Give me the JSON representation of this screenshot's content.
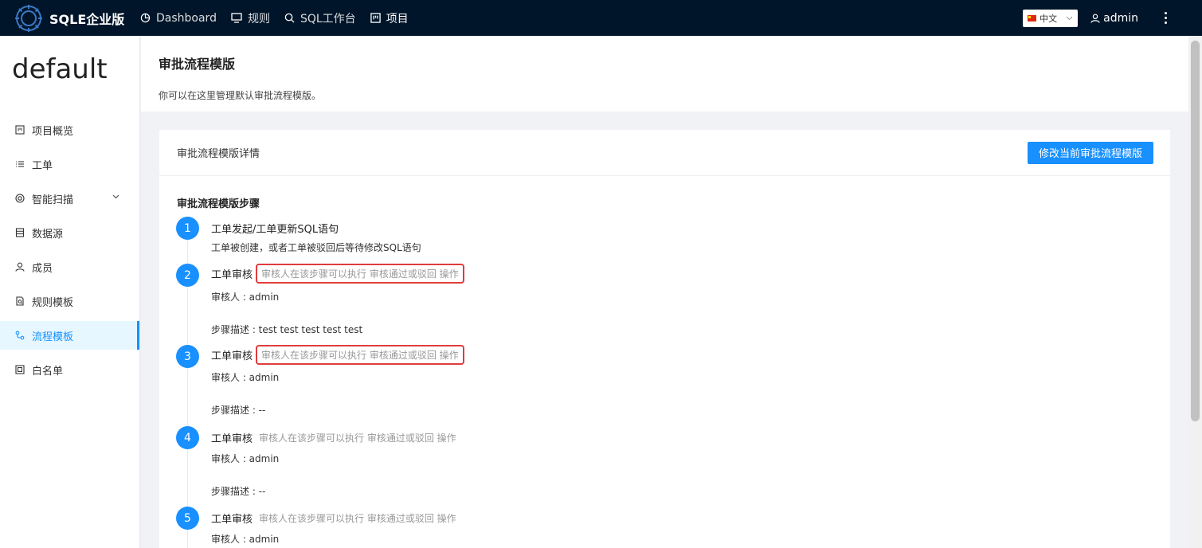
{
  "app": {
    "name": "SQLE企业版"
  },
  "nav": {
    "items": [
      {
        "label": "Dashboard"
      },
      {
        "label": "规则"
      },
      {
        "label": "SQL工作台"
      },
      {
        "label": "项目"
      }
    ]
  },
  "header_right": {
    "language": "中文",
    "user": "admin"
  },
  "sidebar": {
    "project": "default",
    "items": [
      {
        "label": "项目概览"
      },
      {
        "label": "工单"
      },
      {
        "label": "智能扫描"
      },
      {
        "label": "数据源"
      },
      {
        "label": "成员"
      },
      {
        "label": "规则模板"
      },
      {
        "label": "流程模板"
      },
      {
        "label": "白名单"
      }
    ]
  },
  "page": {
    "title": "审批流程模版",
    "description": "你可以在这里管理默认审批流程模版。"
  },
  "card": {
    "title": "审批流程模版详情",
    "edit_button": "修改当前审批流程模版",
    "steps_title": "审批流程模版步骤",
    "steps": [
      {
        "num": "1",
        "title": "工单发起/工单更新SQL语句",
        "hint": "",
        "lines": [
          "工单被创建，或者工单被驳回后等待修改SQL语句"
        ]
      },
      {
        "num": "2",
        "title": "工单审核",
        "hint": "审核人在该步骤可以执行 审核通过或驳回 操作",
        "lines": [
          "审核人 : admin",
          "步骤描述 : test test test test test"
        ]
      },
      {
        "num": "3",
        "title": "工单审核",
        "hint": "审核人在该步骤可以执行 审核通过或驳回 操作",
        "lines": [
          "审核人 : admin",
          "步骤描述 : --"
        ]
      },
      {
        "num": "4",
        "title": "工单审核",
        "hint": "审核人在该步骤可以执行 审核通过或驳回 操作",
        "lines": [
          "审核人 : admin",
          "步骤描述 : --"
        ]
      },
      {
        "num": "5",
        "title": "工单审核",
        "hint": "审核人在该步骤可以执行 审核通过或驳回 操作",
        "lines": [
          "审核人 : admin"
        ]
      }
    ]
  },
  "colors": {
    "nav_bg": "#001529",
    "primary": "#1890ff",
    "highlight_border": "#e03c3c"
  }
}
